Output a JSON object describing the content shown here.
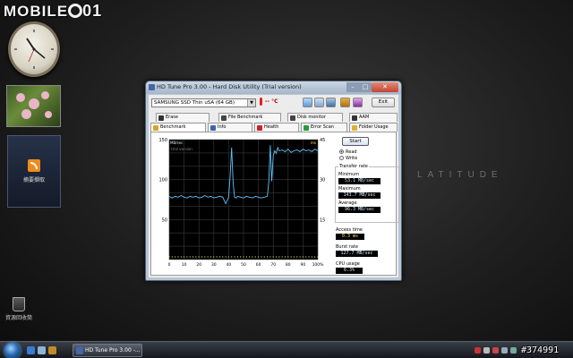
{
  "watermark": {
    "brand": "MOBILE",
    "number": "01"
  },
  "desktop": {
    "brand_text": "LATITUDE",
    "rss_gadget_label": "摘要擷取",
    "recycle_bin_label": "資源回收筒"
  },
  "window": {
    "title": "HD Tune Pro 3.00 - Hard Disk Utility (Trial version)",
    "close_glyph": "✕",
    "minimize_glyph": "–",
    "maximize_glyph": "□",
    "drive": "SAMSUNG SSD Thin uSA (64 GB)",
    "temperature": "-- °C",
    "exit_label": "Exit",
    "tabs_row1": [
      "Erase",
      "File Benchmark",
      "Disk monitor",
      "AAM"
    ],
    "tabs_row2": [
      "Benchmark",
      "Info",
      "Health",
      "Error Scan",
      "Folder Usage"
    ],
    "active_tab": "Benchmark",
    "start_label": "Start",
    "read_label": "Read",
    "write_label": "Write",
    "transfer_rate_title": "Transfer rate",
    "minimum_label": "Minimum",
    "minimum_value": "53.1 MB/sec",
    "maximum_label": "Maximum",
    "maximum_value": "143.7 MB/sec",
    "average_label": "Average",
    "average_value": "96.3 MB/sec",
    "access_label": "Access time",
    "access_value": "0.3 ms",
    "burst_label": "Burst rate",
    "burst_value": "127.7 MB/sec",
    "cpu_label": "CPU usage",
    "cpu_value": "6.3%"
  },
  "chart_data": {
    "type": "line",
    "watermark_text": "trial version",
    "ylabel_left": "MB/sec",
    "ylabel_right": "ms",
    "y_left_ticks": [
      150,
      100,
      50
    ],
    "y_right_ticks": [
      45,
      30,
      15
    ],
    "x_ticks": [
      "0",
      "10",
      "20",
      "30",
      "40",
      "50",
      "60",
      "70",
      "80",
      "90",
      "100%"
    ],
    "ylim": [
      0,
      150
    ],
    "x": [
      0,
      2,
      4,
      6,
      8,
      10,
      12,
      14,
      16,
      18,
      20,
      22,
      24,
      26,
      28,
      30,
      32,
      34,
      36,
      38,
      40,
      41,
      42,
      43,
      44,
      45,
      46,
      48,
      50,
      52,
      54,
      56,
      58,
      60,
      62,
      64,
      66,
      67,
      68,
      69,
      70,
      71,
      72,
      73,
      74,
      76,
      78,
      80,
      82,
      84,
      86,
      88,
      90,
      92,
      94,
      96,
      98,
      100
    ],
    "series": [
      {
        "values": [
          79,
          77,
          79,
          78,
          80,
          78,
          77,
          79,
          78,
          79,
          77,
          78,
          80,
          78,
          79,
          77,
          78,
          79,
          78,
          70,
          78,
          105,
          140,
          96,
          78,
          77,
          79,
          78,
          77,
          79,
          78,
          77,
          79,
          78,
          77,
          78,
          79,
          97,
          143,
          98,
          130,
          136,
          133,
          140,
          136,
          137,
          135,
          138,
          134,
          136,
          137,
          135,
          138,
          136,
          137,
          135,
          138,
          136
        ]
      }
    ]
  },
  "taskbar": {
    "task_label": "HD Tune Pro 3.00 -...",
    "tag": "#374991"
  }
}
